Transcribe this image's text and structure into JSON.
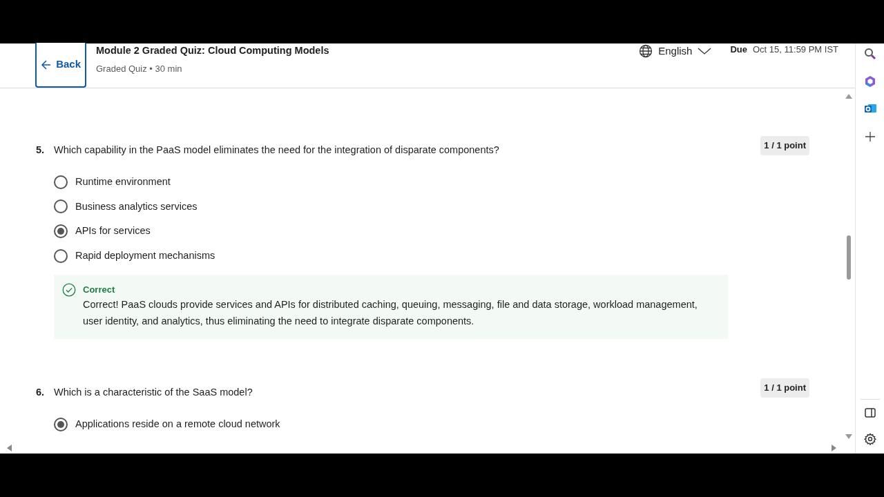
{
  "header": {
    "back": "Back",
    "title": "Module 2 Graded Quiz: Cloud Computing Models",
    "subtitle": "Graded Quiz • 30 min",
    "language": "English",
    "due_label": "Due",
    "due_value": "Oct 15, 11:59 PM IST"
  },
  "questions": [
    {
      "number": "5.",
      "text": "Which capability in the PaaS model eliminates the need for the integration of disparate components?",
      "score": "1 / 1 point",
      "options": [
        {
          "label": "Runtime environment",
          "selected": false
        },
        {
          "label": "Business analytics services",
          "selected": false
        },
        {
          "label": "APIs for services",
          "selected": true
        },
        {
          "label": "Rapid deployment mechanisms",
          "selected": false
        }
      ],
      "feedback": {
        "kind": "correct",
        "label": "Correct",
        "text": "Correct! PaaS clouds provide services and APIs for distributed caching, queuing, messaging, file and data storage, workload management, user identity, and analytics, thus eliminating the need to integrate disparate components."
      }
    },
    {
      "number": "6.",
      "text": "Which is a characteristic of the SaaS model?",
      "score": "1 / 1 point",
      "options": [
        {
          "label": "Applications reside on a remote cloud network",
          "selected": true
        }
      ]
    }
  ]
}
